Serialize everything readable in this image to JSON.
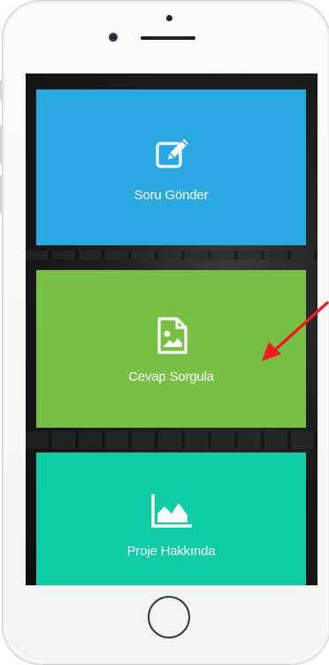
{
  "colors": {
    "tile_blue": "#29a8e2",
    "tile_green": "#78c045",
    "tile_teal": "#10cca6",
    "arrow": "#ee1c1c"
  },
  "menu": {
    "items": [
      {
        "label": "Soru Gönder",
        "icon": "edit-icon"
      },
      {
        "label": "Cevap Sorgula",
        "icon": "image-file-icon"
      },
      {
        "label": "Proje Hakkında",
        "icon": "area-chart-icon"
      }
    ]
  }
}
